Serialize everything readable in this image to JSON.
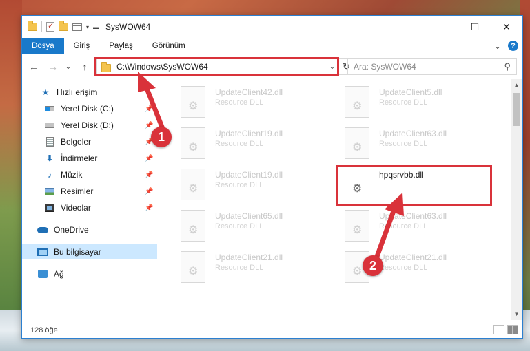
{
  "window": {
    "title": "SysWOW64"
  },
  "controls": {
    "minimize": "—",
    "maximize": "☐",
    "close": "✕"
  },
  "ribbon": {
    "tabs": [
      "Dosya",
      "Giriş",
      "Paylaş",
      "Görünüm"
    ],
    "expand_chevron": "⌄",
    "help": "?"
  },
  "nav": {
    "back": "←",
    "forward": "→",
    "recent": "⌄",
    "up": "↑",
    "address": "C:\\Windows\\SysWOW64",
    "address_dropdown": "⌄",
    "refresh": "↻",
    "search_placeholder": "Ara: SysWOW64"
  },
  "sidebar": {
    "items": [
      {
        "label": "Hızlı erişim",
        "icon": "star-icon"
      },
      {
        "label": "Yerel Disk (C:)",
        "icon": "drive-c-icon",
        "pinned": true
      },
      {
        "label": "Yerel Disk (D:)",
        "icon": "drive-d-icon",
        "pinned": true
      },
      {
        "label": "Belgeler",
        "icon": "document-icon",
        "pinned": true
      },
      {
        "label": "İndirmeler",
        "icon": "download-icon",
        "pinned": true
      },
      {
        "label": "Müzik",
        "icon": "music-icon",
        "pinned": true
      },
      {
        "label": "Resimler",
        "icon": "pictures-icon",
        "pinned": true
      },
      {
        "label": "Videolar",
        "icon": "videos-icon",
        "pinned": true
      },
      {
        "label": "OneDrive",
        "icon": "onedrive-icon"
      },
      {
        "label": "Bu bilgisayar",
        "icon": "pc-icon",
        "selected": true
      },
      {
        "label": "Ağ",
        "icon": "network-icon"
      }
    ]
  },
  "files": [
    {
      "name": "UpdateClient42.dll",
      "type": "Resource DLL"
    },
    {
      "name": "UpdateClient5.dll",
      "type": "Resource DLL"
    },
    {
      "name": "UpdateClient19.dll",
      "type": "Resource DLL"
    },
    {
      "name": "UpdateClient63.dll",
      "type": "Resource DLL"
    },
    {
      "name": "UpdateClient19.dll",
      "type": "Resource DLL"
    },
    {
      "name": "hpqsrvbb.dll",
      "type": ""
    },
    {
      "name": "UpdateClient65.dll",
      "type": "Resource DLL"
    },
    {
      "name": "UpdateClient63.dll",
      "type": "Resource DLL"
    },
    {
      "name": "UpdateClient21.dll",
      "type": "Resource DLL"
    },
    {
      "name": "UpdateClient21.dll",
      "type": "Resource DLL"
    }
  ],
  "status": {
    "count": "128 öğe"
  },
  "callouts": [
    "1",
    "2"
  ],
  "colors": {
    "highlight": "#d9323a",
    "accent": "#1979ca"
  }
}
